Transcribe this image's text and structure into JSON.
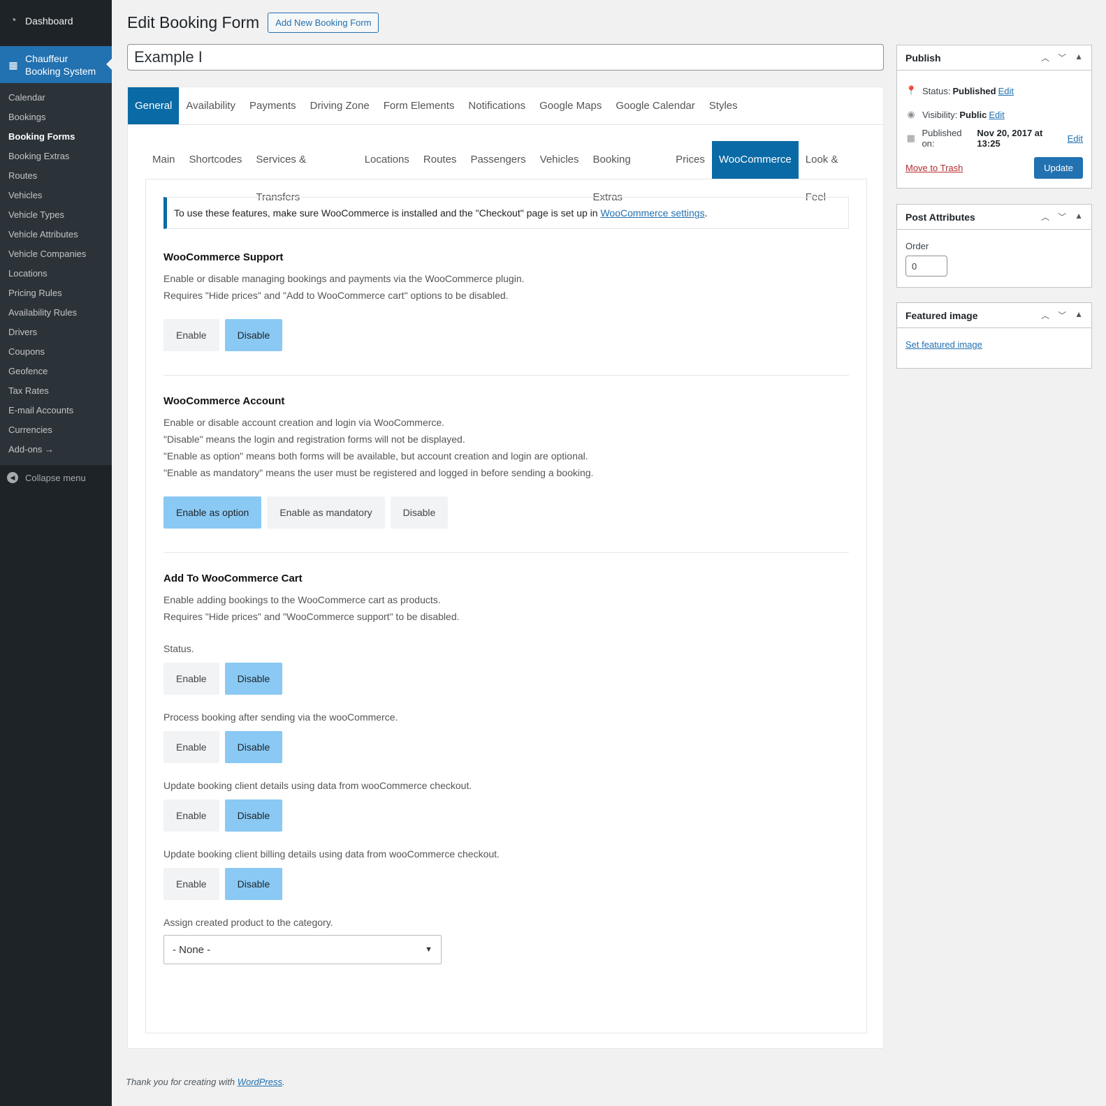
{
  "sidebar": {
    "dashboard": "Dashboard",
    "active_plugin": "Chauffeur Booking System",
    "items": [
      {
        "label": "Calendar",
        "current": false
      },
      {
        "label": "Bookings",
        "current": false
      },
      {
        "label": "Booking Forms",
        "current": true
      },
      {
        "label": "Booking Extras",
        "current": false
      },
      {
        "label": "Routes",
        "current": false
      },
      {
        "label": "Vehicles",
        "current": false
      },
      {
        "label": "Vehicle Types",
        "current": false
      },
      {
        "label": "Vehicle Attributes",
        "current": false
      },
      {
        "label": "Vehicle Companies",
        "current": false
      },
      {
        "label": "Locations",
        "current": false
      },
      {
        "label": "Pricing Rules",
        "current": false
      },
      {
        "label": "Availability Rules",
        "current": false
      },
      {
        "label": "Drivers",
        "current": false
      },
      {
        "label": "Coupons",
        "current": false
      },
      {
        "label": "Geofence",
        "current": false
      },
      {
        "label": "Tax Rates",
        "current": false
      },
      {
        "label": "E-mail Accounts",
        "current": false
      },
      {
        "label": "Currencies",
        "current": false
      },
      {
        "label": "Add-ons →",
        "current": false
      }
    ],
    "collapse": "Collapse menu"
  },
  "header": {
    "title": "Edit Booking Form",
    "add_new": "Add New Booking Form"
  },
  "post_title": "Example I",
  "tabs_main": [
    "General",
    "Availability",
    "Payments",
    "Driving Zone",
    "Form Elements",
    "Notifications",
    "Google Maps",
    "Google Calendar",
    "Styles"
  ],
  "tabs_sub": [
    "Main",
    "Shortcodes",
    "Services & Transfers",
    "Locations",
    "Routes",
    "Passengers",
    "Vehicles",
    "Booking Extras",
    "Prices",
    "WooCommerce",
    "Look & Feel"
  ],
  "notice": {
    "text": "To use these features, make sure WooCommerce is installed and the \"Checkout\" page is set up in ",
    "link": "WooCommerce settings",
    "end": "."
  },
  "support": {
    "heading": "WooCommerce Support",
    "line1": "Enable or disable managing bookings and payments via the WooCommerce plugin.",
    "line2": "Requires \"Hide prices\" and \"Add to WooCommerce cart\" options to be disabled.",
    "enable": "Enable",
    "disable": "Disable"
  },
  "account": {
    "heading": "WooCommerce Account",
    "line1": "Enable or disable account creation and login via WooCommerce.",
    "line2": "\"Disable\" means the login and registration forms will not be displayed.",
    "line3": "\"Enable as option\" means both forms will be available, but account creation and login are optional.",
    "line4": "\"Enable as mandatory\" means the user must be registered and logged in before sending a booking.",
    "opt1": "Enable as option",
    "opt2": "Enable as mandatory",
    "opt3": "Disable"
  },
  "cart": {
    "heading": "Add To WooCommerce Cart",
    "line1": "Enable adding bookings to the WooCommerce cart as products.",
    "line2": "Requires \"Hide prices\" and \"WooCommerce support\" to be disabled.",
    "status_label": "Status.",
    "process_label": "Process booking after sending via the wooCommerce.",
    "update_label": "Update booking client details using data from wooCommerce checkout.",
    "billing_label": "Update booking client billing details using data from wooCommerce checkout.",
    "category_label": "Assign created product to the category.",
    "category_value": "- None -",
    "enable": "Enable",
    "disable": "Disable"
  },
  "footer": {
    "text": "Thank you for creating with ",
    "link": "WordPress",
    "end": "."
  },
  "publish": {
    "title": "Publish",
    "status_label": "Status:",
    "status_value": "Published",
    "visibility_label": "Visibility:",
    "visibility_value": "Public",
    "published_label": "Published on:",
    "published_value": "Nov 20, 2017 at 13:25",
    "edit": "Edit",
    "trash": "Move to Trash",
    "update": "Update"
  },
  "attributes": {
    "title": "Post Attributes",
    "order_label": "Order",
    "order_value": "0"
  },
  "featured": {
    "title": "Featured image",
    "link": "Set featured image"
  }
}
